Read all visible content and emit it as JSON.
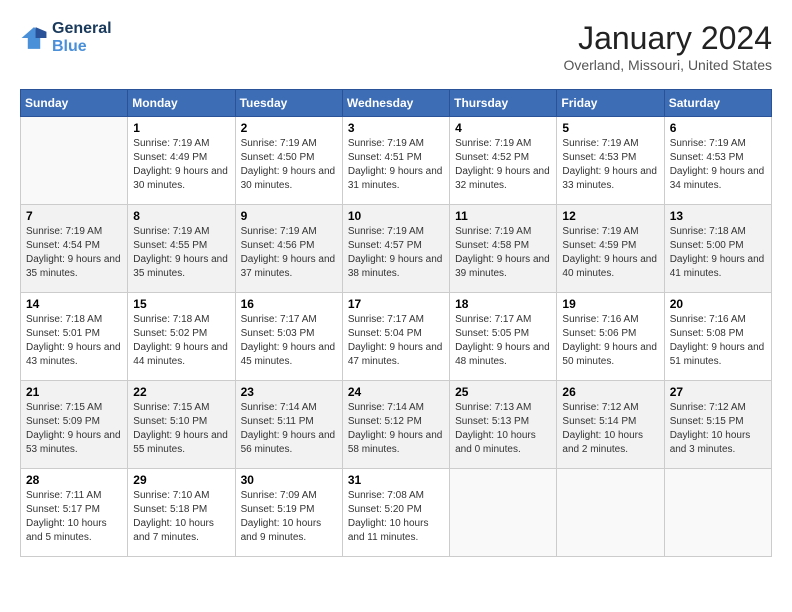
{
  "header": {
    "logo_line1": "General",
    "logo_line2": "Blue",
    "month_year": "January 2024",
    "location": "Overland, Missouri, United States"
  },
  "weekdays": [
    "Sunday",
    "Monday",
    "Tuesday",
    "Wednesday",
    "Thursday",
    "Friday",
    "Saturday"
  ],
  "weeks": [
    [
      {
        "day": "",
        "sunrise": "",
        "sunset": "",
        "daylight": ""
      },
      {
        "day": "1",
        "sunrise": "7:19 AM",
        "sunset": "4:49 PM",
        "daylight": "9 hours and 30 minutes."
      },
      {
        "day": "2",
        "sunrise": "7:19 AM",
        "sunset": "4:50 PM",
        "daylight": "9 hours and 30 minutes."
      },
      {
        "day": "3",
        "sunrise": "7:19 AM",
        "sunset": "4:51 PM",
        "daylight": "9 hours and 31 minutes."
      },
      {
        "day": "4",
        "sunrise": "7:19 AM",
        "sunset": "4:52 PM",
        "daylight": "9 hours and 32 minutes."
      },
      {
        "day": "5",
        "sunrise": "7:19 AM",
        "sunset": "4:53 PM",
        "daylight": "9 hours and 33 minutes."
      },
      {
        "day": "6",
        "sunrise": "7:19 AM",
        "sunset": "4:53 PM",
        "daylight": "9 hours and 34 minutes."
      }
    ],
    [
      {
        "day": "7",
        "sunrise": "7:19 AM",
        "sunset": "4:54 PM",
        "daylight": "9 hours and 35 minutes."
      },
      {
        "day": "8",
        "sunrise": "7:19 AM",
        "sunset": "4:55 PM",
        "daylight": "9 hours and 35 minutes."
      },
      {
        "day": "9",
        "sunrise": "7:19 AM",
        "sunset": "4:56 PM",
        "daylight": "9 hours and 37 minutes."
      },
      {
        "day": "10",
        "sunrise": "7:19 AM",
        "sunset": "4:57 PM",
        "daylight": "9 hours and 38 minutes."
      },
      {
        "day": "11",
        "sunrise": "7:19 AM",
        "sunset": "4:58 PM",
        "daylight": "9 hours and 39 minutes."
      },
      {
        "day": "12",
        "sunrise": "7:19 AM",
        "sunset": "4:59 PM",
        "daylight": "9 hours and 40 minutes."
      },
      {
        "day": "13",
        "sunrise": "7:18 AM",
        "sunset": "5:00 PM",
        "daylight": "9 hours and 41 minutes."
      }
    ],
    [
      {
        "day": "14",
        "sunrise": "7:18 AM",
        "sunset": "5:01 PM",
        "daylight": "9 hours and 43 minutes."
      },
      {
        "day": "15",
        "sunrise": "7:18 AM",
        "sunset": "5:02 PM",
        "daylight": "9 hours and 44 minutes."
      },
      {
        "day": "16",
        "sunrise": "7:17 AM",
        "sunset": "5:03 PM",
        "daylight": "9 hours and 45 minutes."
      },
      {
        "day": "17",
        "sunrise": "7:17 AM",
        "sunset": "5:04 PM",
        "daylight": "9 hours and 47 minutes."
      },
      {
        "day": "18",
        "sunrise": "7:17 AM",
        "sunset": "5:05 PM",
        "daylight": "9 hours and 48 minutes."
      },
      {
        "day": "19",
        "sunrise": "7:16 AM",
        "sunset": "5:06 PM",
        "daylight": "9 hours and 50 minutes."
      },
      {
        "day": "20",
        "sunrise": "7:16 AM",
        "sunset": "5:08 PM",
        "daylight": "9 hours and 51 minutes."
      }
    ],
    [
      {
        "day": "21",
        "sunrise": "7:15 AM",
        "sunset": "5:09 PM",
        "daylight": "9 hours and 53 minutes."
      },
      {
        "day": "22",
        "sunrise": "7:15 AM",
        "sunset": "5:10 PM",
        "daylight": "9 hours and 55 minutes."
      },
      {
        "day": "23",
        "sunrise": "7:14 AM",
        "sunset": "5:11 PM",
        "daylight": "9 hours and 56 minutes."
      },
      {
        "day": "24",
        "sunrise": "7:14 AM",
        "sunset": "5:12 PM",
        "daylight": "9 hours and 58 minutes."
      },
      {
        "day": "25",
        "sunrise": "7:13 AM",
        "sunset": "5:13 PM",
        "daylight": "10 hours and 0 minutes."
      },
      {
        "day": "26",
        "sunrise": "7:12 AM",
        "sunset": "5:14 PM",
        "daylight": "10 hours and 2 minutes."
      },
      {
        "day": "27",
        "sunrise": "7:12 AM",
        "sunset": "5:15 PM",
        "daylight": "10 hours and 3 minutes."
      }
    ],
    [
      {
        "day": "28",
        "sunrise": "7:11 AM",
        "sunset": "5:17 PM",
        "daylight": "10 hours and 5 minutes."
      },
      {
        "day": "29",
        "sunrise": "7:10 AM",
        "sunset": "5:18 PM",
        "daylight": "10 hours and 7 minutes."
      },
      {
        "day": "30",
        "sunrise": "7:09 AM",
        "sunset": "5:19 PM",
        "daylight": "10 hours and 9 minutes."
      },
      {
        "day": "31",
        "sunrise": "7:08 AM",
        "sunset": "5:20 PM",
        "daylight": "10 hours and 11 minutes."
      },
      {
        "day": "",
        "sunrise": "",
        "sunset": "",
        "daylight": ""
      },
      {
        "day": "",
        "sunrise": "",
        "sunset": "",
        "daylight": ""
      },
      {
        "day": "",
        "sunrise": "",
        "sunset": "",
        "daylight": ""
      }
    ]
  ],
  "labels": {
    "sunrise": "Sunrise:",
    "sunset": "Sunset:",
    "daylight": "Daylight:"
  }
}
